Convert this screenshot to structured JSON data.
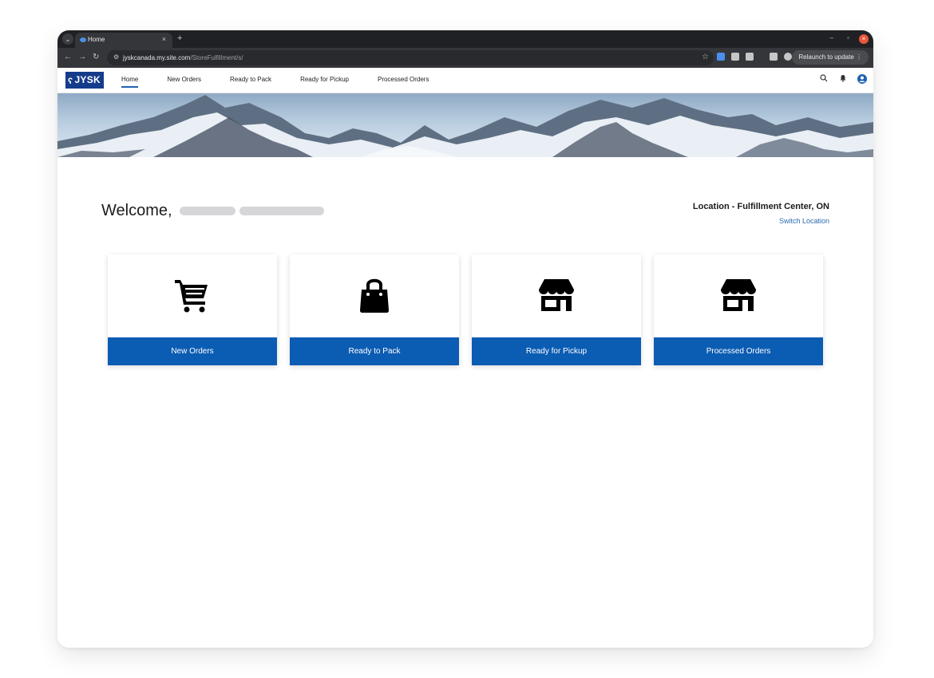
{
  "browser": {
    "tab_title": "Home",
    "tab_close": "×",
    "new_tab": "+",
    "url_host": "jyskcanada.my.site.com",
    "url_path": "/StoreFulfillment/s/",
    "relaunch_label": "Relaunch to update",
    "relaunch_menu": "⋮"
  },
  "site": {
    "logo_text": "JYSK",
    "nav": [
      {
        "label": "Home",
        "active": true
      },
      {
        "label": "New Orders",
        "active": false
      },
      {
        "label": "Ready to Pack",
        "active": false
      },
      {
        "label": "Ready for Pickup",
        "active": false
      },
      {
        "label": "Processed Orders",
        "active": false
      }
    ],
    "header_icons": [
      "search-icon",
      "bell-icon",
      "user-avatar-icon"
    ]
  },
  "main": {
    "welcome": "Welcome,",
    "location": "Location - Fulfillment Center, ON",
    "switch_location": "Switch Location",
    "cards": [
      {
        "label": "New Orders",
        "icon": "shopping-cart-icon"
      },
      {
        "label": "Ready to Pack",
        "icon": "shopping-bag-icon"
      },
      {
        "label": "Ready for Pickup",
        "icon": "storefront-icon"
      },
      {
        "label": "Processed Orders",
        "icon": "storefront-icon"
      }
    ]
  },
  "colors": {
    "brand_blue": "#143c8a",
    "card_bar_blue": "#0b5cb3",
    "link_blue": "#2b6cb0",
    "chrome_dark": "#202124"
  }
}
